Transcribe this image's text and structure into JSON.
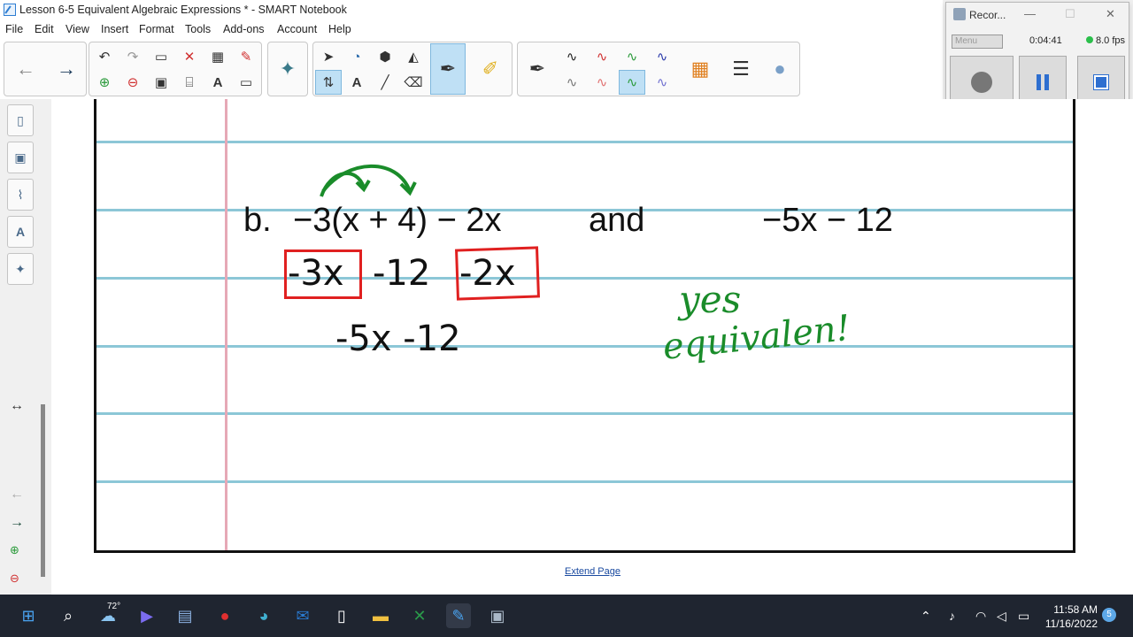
{
  "window": {
    "title": "Lesson 6-5 Equivalent Algebraic Expressions * - SMART Notebook"
  },
  "menu": [
    "File",
    "Edit",
    "View",
    "Insert",
    "Format",
    "Tools",
    "Add-ons",
    "Account",
    "Help"
  ],
  "recorder": {
    "title": "Recor...",
    "menu_label": "Menu",
    "time": "0:04:41",
    "fps": "8.0 fps"
  },
  "page": {
    "problem_label": "b.",
    "expression_1": "−3(x + 4) − 2x",
    "and_word": "and",
    "expression_2": "−5x − 12",
    "work_step_1a": "-3x",
    "work_step_1b": "-12",
    "work_step_1c": "-2x",
    "work_step_2": "-5x -12",
    "answer_line1": "yes",
    "answer_line2": "equivalen!",
    "extend_link": "Extend Page"
  },
  "taskbar": {
    "weather": "72°",
    "time": "11:58 AM",
    "date": "11/16/2022",
    "notifications": "5"
  },
  "colors": {
    "ink_red": "#e02020",
    "ink_green": "#1a8c2a",
    "rule_blue": "#8cc7d7",
    "margin_pink": "#e6a8b6"
  }
}
